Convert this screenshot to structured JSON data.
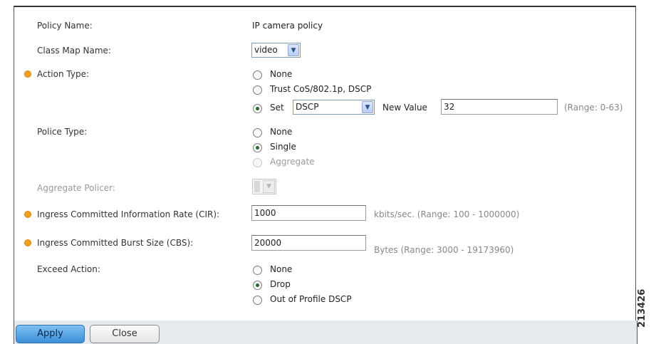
{
  "form": {
    "policy_name": {
      "label": "Policy Name:",
      "value": "IP camera policy"
    },
    "class_map": {
      "label": "Class Map Name:",
      "value": "video"
    },
    "action_type": {
      "label": "Action Type:",
      "options": [
        "None",
        "Trust CoS/802.1p, DSCP",
        "Set"
      ],
      "selected": "Set",
      "set_select_value": "DSCP",
      "new_value_label": "New Value",
      "new_value": "32",
      "range": "(Range: 0-63)"
    },
    "police_type": {
      "label": "Police Type:",
      "options": [
        "None",
        "Single",
        "Aggregate"
      ],
      "selected": "Single"
    },
    "aggregate_policer": {
      "label": "Aggregate Policer:"
    },
    "cir": {
      "label": "Ingress Committed Information Rate (CIR):",
      "value": "1000",
      "hint": "kbits/sec. (Range: 100 - 1000000)"
    },
    "cbs": {
      "label": "Ingress Committed Burst Size (CBS):",
      "value": "20000",
      "hint": "Bytes (Range: 3000 - 19173960)"
    },
    "exceed_action": {
      "label": "Exceed Action:",
      "options": [
        "None",
        "Drop",
        "Out of Profile DSCP"
      ],
      "selected": "Drop"
    }
  },
  "buttons": {
    "apply": "Apply",
    "close": "Close"
  },
  "figure_id": "213426",
  "icons": {
    "required": "required-asterisk-icon",
    "dropdown": "chevron-down-icon"
  },
  "colors": {
    "required": "#f0a020",
    "primary_button": "#3b8fd8",
    "footer": "#e6eaee"
  }
}
